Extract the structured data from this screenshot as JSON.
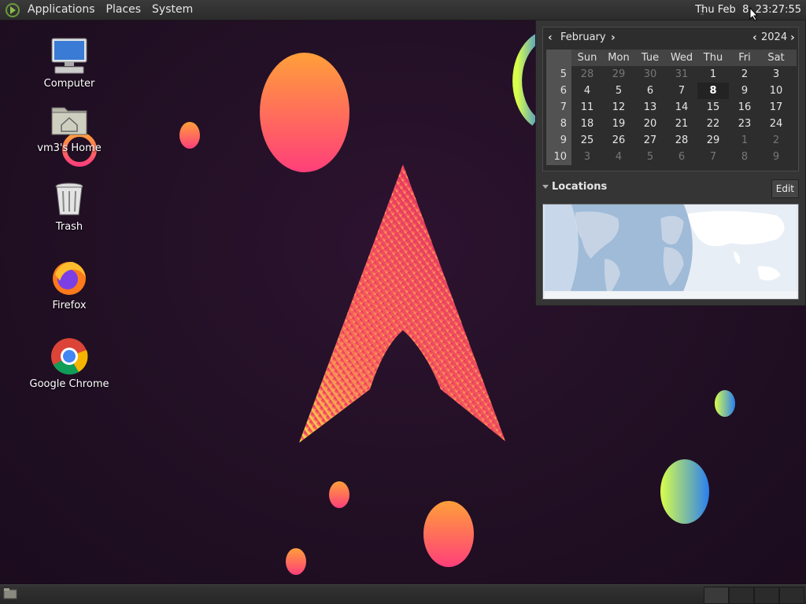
{
  "top_panel": {
    "menus": [
      "Applications",
      "Places",
      "System"
    ],
    "clock": "Thu Feb  8, 23:27:55"
  },
  "desktop_icons": [
    {
      "label": "Computer",
      "icon": "computer-icon"
    },
    {
      "label": "vm3's Home",
      "icon": "home-folder-icon"
    },
    {
      "label": "Trash",
      "icon": "trash-icon"
    },
    {
      "label": "Firefox",
      "icon": "firefox-icon"
    },
    {
      "label": "Google Chrome",
      "icon": "chrome-icon"
    }
  ],
  "calendar": {
    "month": "February",
    "year": "2024",
    "weekdays": [
      "Sun",
      "Mon",
      "Tue",
      "Wed",
      "Thu",
      "Fri",
      "Sat"
    ],
    "weeks": [
      {
        "num": "5",
        "days": [
          "28",
          "29",
          "30",
          "31",
          "1",
          "2",
          "3"
        ]
      },
      {
        "num": "6",
        "days": [
          "4",
          "5",
          "6",
          "7",
          "8",
          "9",
          "10"
        ]
      },
      {
        "num": "7",
        "days": [
          "11",
          "12",
          "13",
          "14",
          "15",
          "16",
          "17"
        ]
      },
      {
        "num": "8",
        "days": [
          "18",
          "19",
          "20",
          "21",
          "22",
          "23",
          "24"
        ]
      },
      {
        "num": "9",
        "days": [
          "25",
          "26",
          "27",
          "28",
          "29",
          "1",
          "2"
        ]
      },
      {
        "num": "10",
        "days": [
          "3",
          "4",
          "5",
          "6",
          "7",
          "8",
          "9"
        ]
      }
    ],
    "today": "8"
  },
  "locations": {
    "title": "Locations",
    "edit_label": "Edit"
  },
  "colors": {
    "accent_orange": "#ff8a3c",
    "accent_pink": "#e8336f",
    "panel_bg": "#2c2c2c"
  }
}
